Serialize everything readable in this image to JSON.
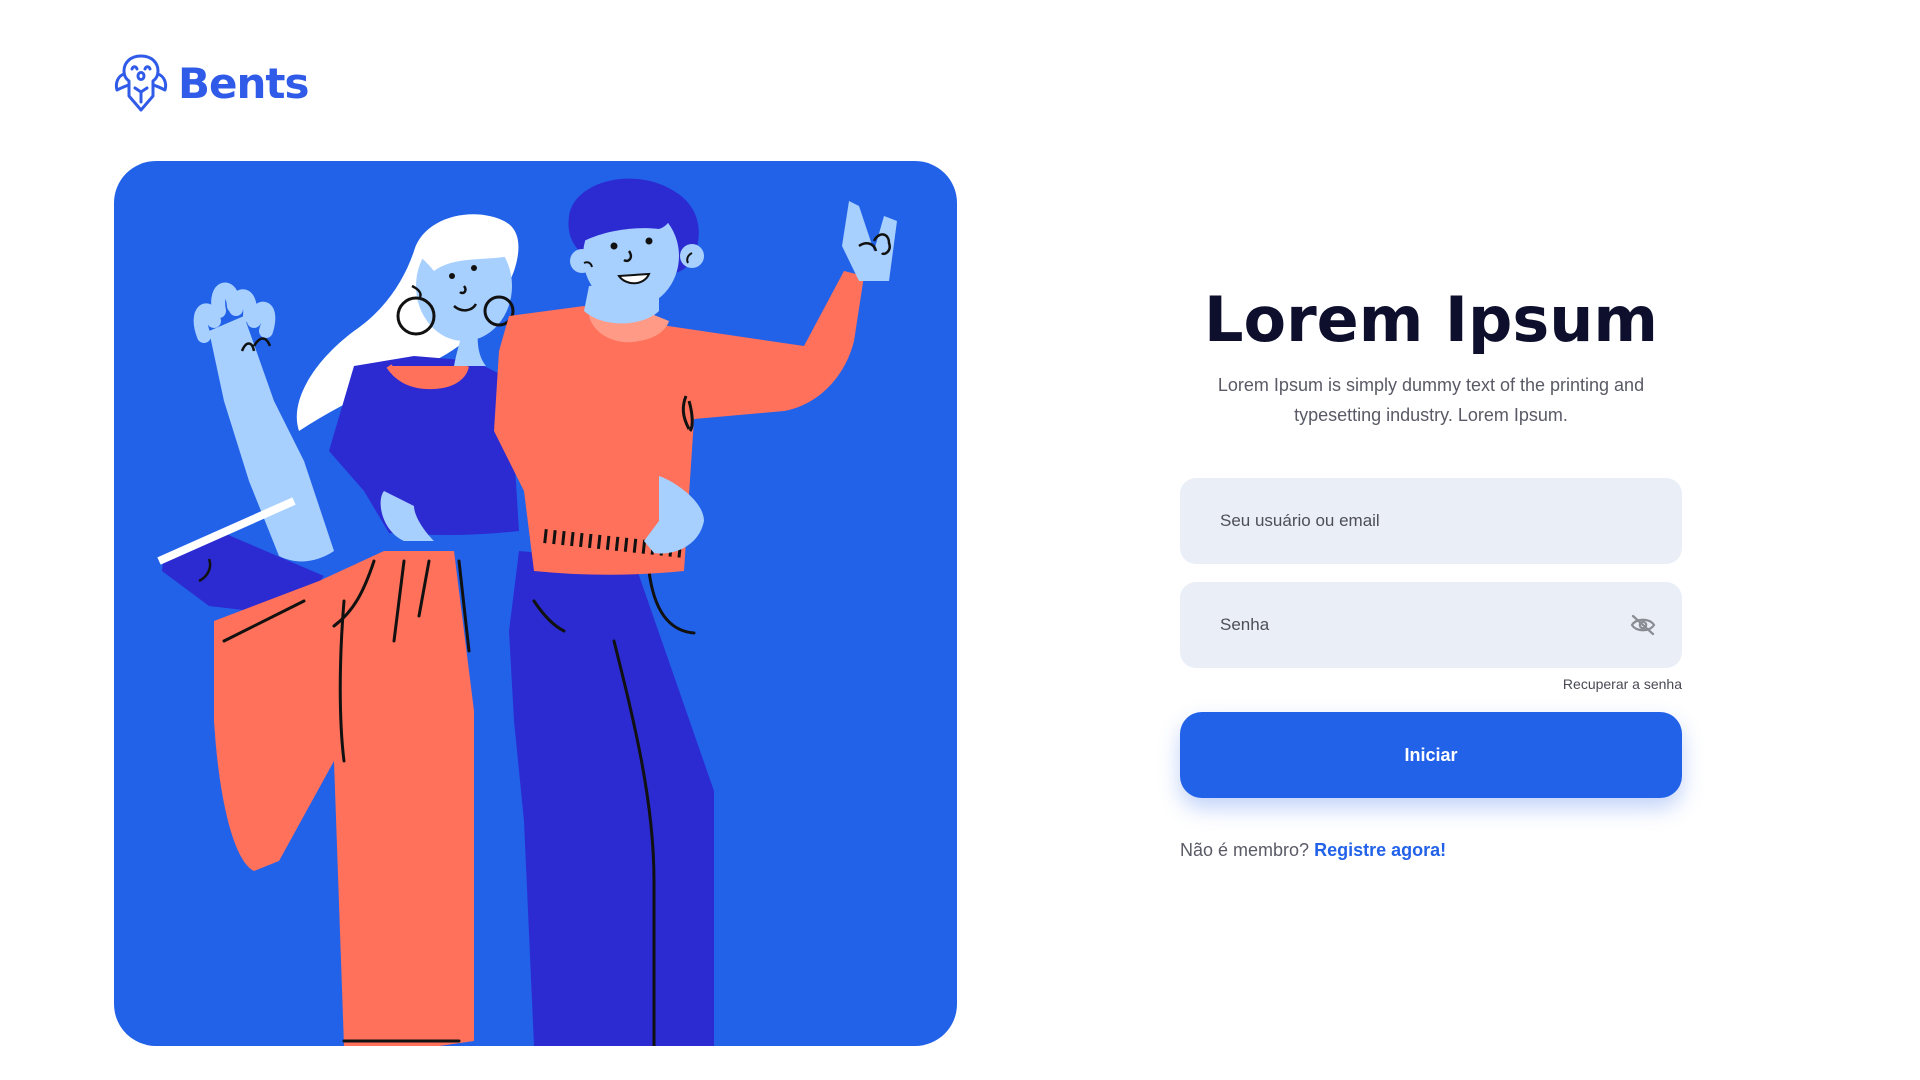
{
  "brand": {
    "name": "Bents",
    "color": "#2f5be8"
  },
  "hero": {
    "background_color": "#2262e9",
    "illustration": "two-friends-waving-illustration"
  },
  "login": {
    "title": "Lorem Ipsum",
    "subtitle": "Lorem Ipsum is simply dummy text of the printing and typesetting industry. Lorem Ipsum.",
    "username_placeholder": "Seu usuário ou email",
    "password_placeholder": "Senha",
    "password_toggle_icon": "eye-off-icon",
    "recover_label": "Recuperar a senha",
    "submit_label": "Iniciar",
    "signup_prompt": "Não é membro?",
    "signup_link": "Registre agora!",
    "accent_color": "#2262e9",
    "field_background": "#e9eef7"
  }
}
